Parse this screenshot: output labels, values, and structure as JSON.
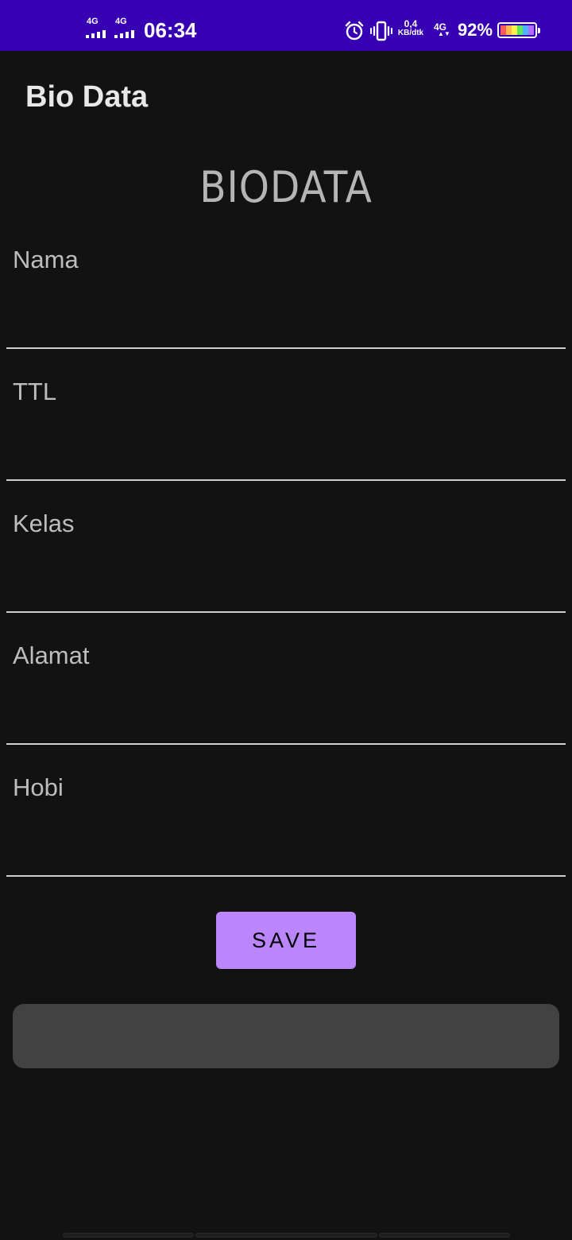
{
  "status_bar": {
    "sim1_network": "4G",
    "sim2_network": "4G",
    "time": "06:34",
    "speed_value": "0,4",
    "speed_unit": "KB/dtk",
    "data_network": "4G",
    "data_arrows": "▲▼",
    "battery_percent": "92%",
    "battery_colors": [
      "#ff5a5a",
      "#ffb84d",
      "#fff04d",
      "#5ee65e",
      "#4db3ff",
      "#b36bff"
    ],
    "background": "#3700b3"
  },
  "app_bar": {
    "title": "Bio Data"
  },
  "form": {
    "heading": "BIODATA",
    "fields": [
      {
        "label": "Nama",
        "value": ""
      },
      {
        "label": "TTL",
        "value": ""
      },
      {
        "label": "Kelas",
        "value": ""
      },
      {
        "label": "Alamat",
        "value": ""
      },
      {
        "label": "Hobi",
        "value": ""
      }
    ],
    "save_label": "SAVE",
    "output_text": ""
  },
  "colors": {
    "background": "#121212",
    "accent": "#bb86fc",
    "output_box": "#424242"
  }
}
